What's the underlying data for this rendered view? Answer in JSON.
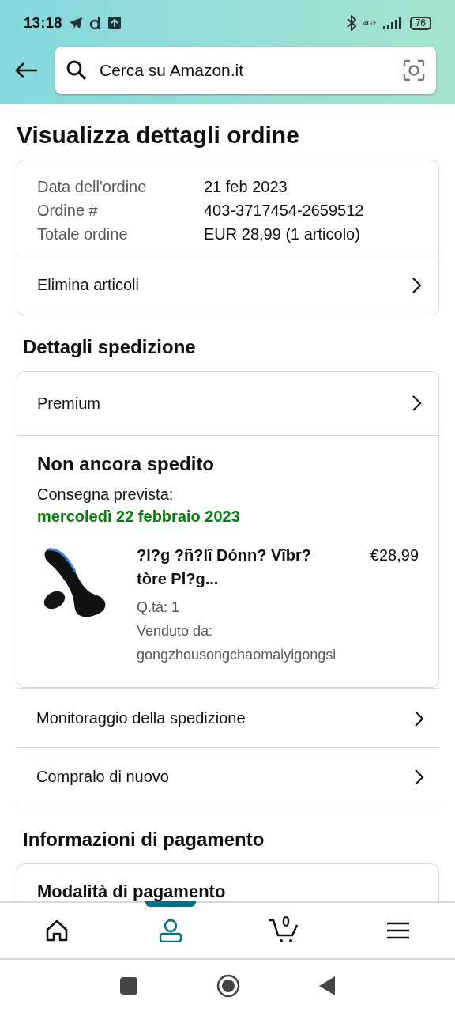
{
  "status_bar": {
    "time": "13:18",
    "network": "4G+",
    "battery": "76"
  },
  "search": {
    "placeholder": "Cerca su Amazon.it"
  },
  "page_title": "Visualizza dettagli ordine",
  "order_summary": {
    "rows": [
      {
        "label": "Data dell'ordine",
        "value": "21 feb 2023"
      },
      {
        "label": "Ordine #",
        "value": "403-3717454-2659512"
      },
      {
        "label": "Totale ordine",
        "value": "EUR 28,99 (1 articolo)"
      }
    ],
    "link": "Elimina articoli"
  },
  "shipping": {
    "heading": "Dettagli spedizione",
    "method": "Premium",
    "status": "Non ancora spedito",
    "delivery_label": "Consegna prevista:",
    "delivery_date": "mercoledì 22 febbraio 2023",
    "items": [
      {
        "title": "?l?g ?ñ?lî Dónn? Vîbr? tòre Pl?g...",
        "price": "€28,99",
        "quantity": "Q.tà: 1",
        "seller_label": "Venduto da:",
        "seller": "gongzhousongchaomaiyigongsi"
      }
    ],
    "actions": [
      "Monitoraggio della spedizione",
      "Compralo di nuovo"
    ]
  },
  "payment": {
    "heading": "Informazioni di pagamento",
    "card_title": "Modalità di pagamento"
  },
  "bottom_nav": [
    {
      "kind": "home",
      "selected": false
    },
    {
      "kind": "account",
      "selected": true
    },
    {
      "kind": "cart",
      "selected": false,
      "count": "0"
    },
    {
      "kind": "menu",
      "selected": false
    }
  ]
}
